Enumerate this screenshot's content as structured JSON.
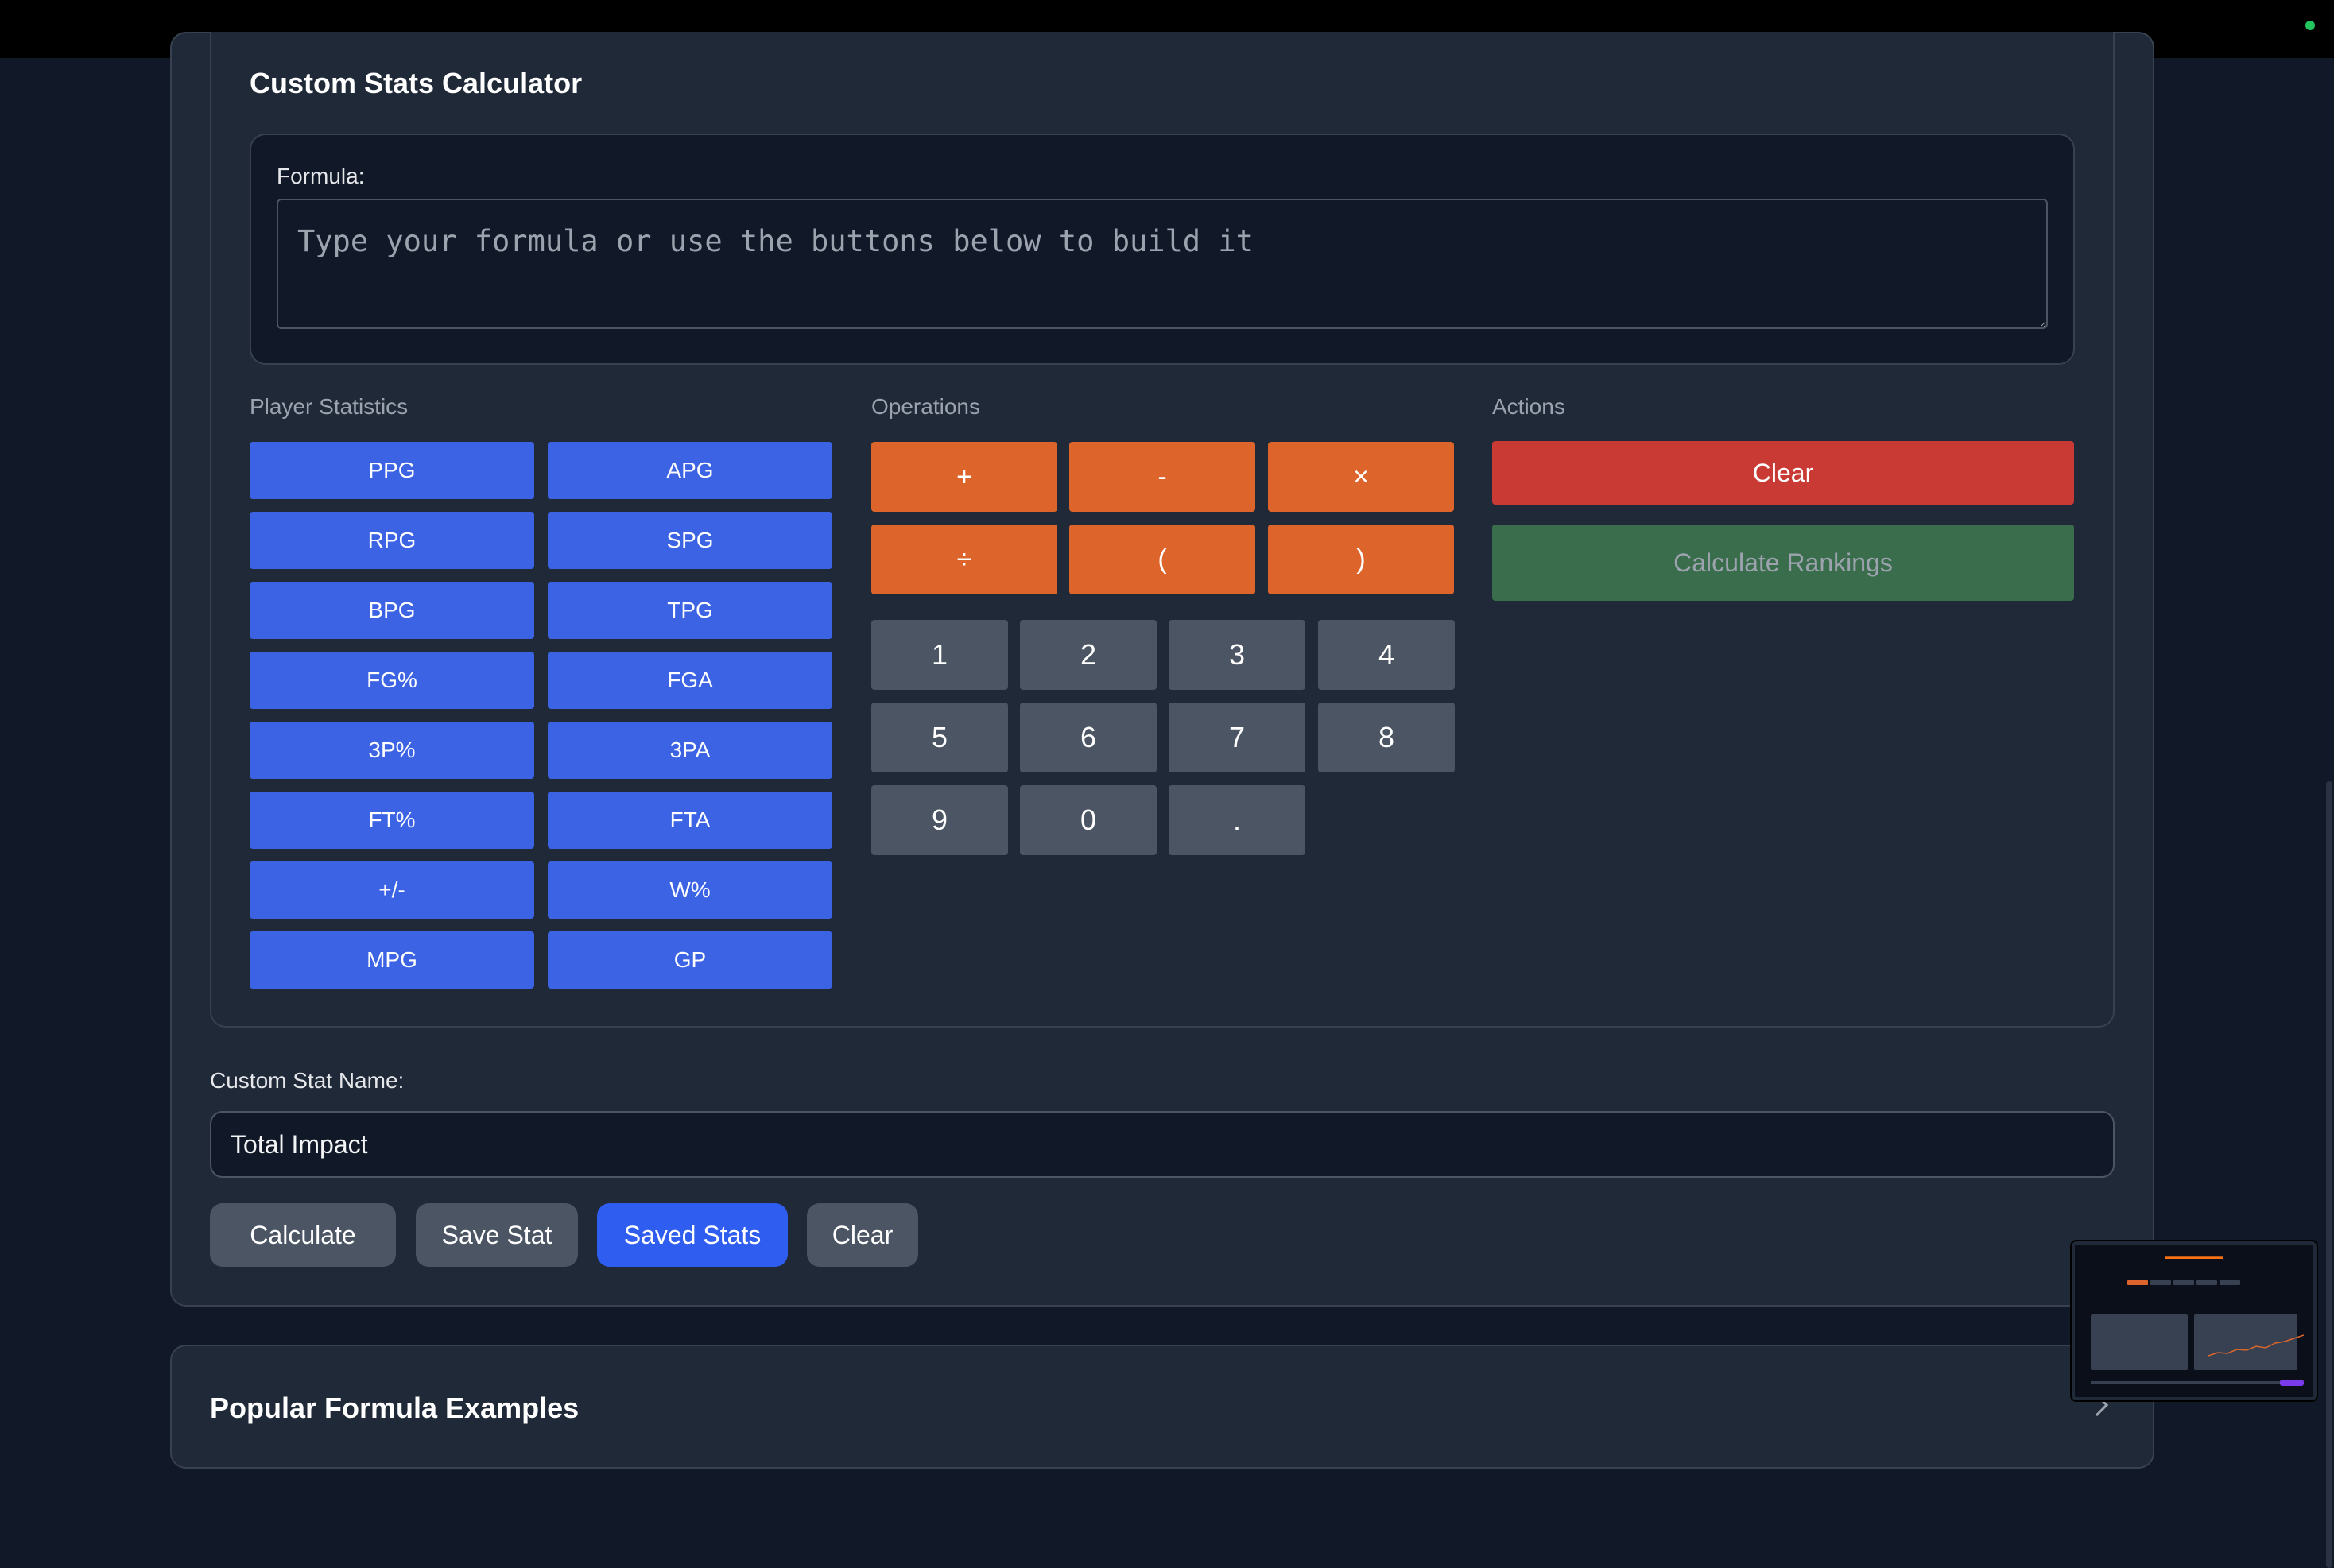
{
  "calculator": {
    "title": "Custom Stats Calculator",
    "formula_label": "Formula:",
    "formula_placeholder": "Type your formula or use the buttons below to build it",
    "formula_value": "",
    "player_statistics_label": "Player Statistics",
    "operations_label": "Operations",
    "actions_label": "Actions",
    "stats": [
      "PPG",
      "APG",
      "RPG",
      "SPG",
      "BPG",
      "TPG",
      "FG%",
      "FGA",
      "3P%",
      "3PA",
      "FT%",
      "FTA",
      "+/-",
      "W%",
      "MPG",
      "GP"
    ],
    "operators": [
      "+",
      "-",
      "×",
      "÷",
      "(",
      ")"
    ],
    "numbers": [
      "1",
      "2",
      "3",
      "4",
      "5",
      "6",
      "7",
      "8",
      "9",
      "0",
      "."
    ],
    "clear_label": "Clear",
    "calculate_rankings_label": "Calculate Rankings"
  },
  "custom_stat": {
    "name_label": "Custom Stat Name:",
    "name_value": "Total Impact",
    "calculate_label": "Calculate",
    "save_label": "Save Stat",
    "saved_label": "Saved Stats",
    "clear_label": "Clear"
  },
  "examples": {
    "title": "Popular Formula Examples"
  },
  "colors": {
    "stat_button": "#3b63e3",
    "operator_button": "#dd652b",
    "number_button": "#4b5563",
    "clear_button": "#c83a33",
    "rankings_button": "#3a6d4b",
    "saved_stats_button": "#2e5df0"
  }
}
